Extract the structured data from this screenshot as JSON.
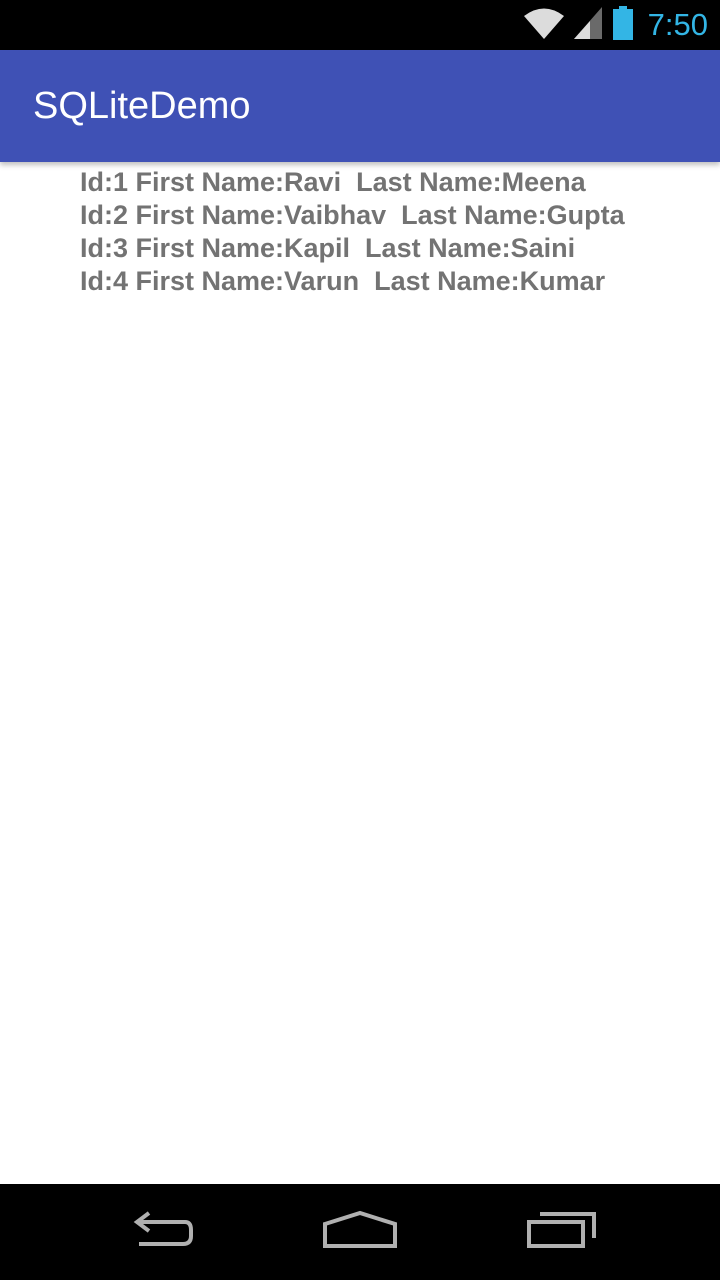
{
  "status_bar": {
    "time": "7:50",
    "icons": [
      "wifi-icon",
      "cellular-signal-icon",
      "battery-icon"
    ],
    "colors": {
      "background": "#000000",
      "time": "#33b5e5",
      "battery": "#33b5e5",
      "icons": "#dcdcdc"
    }
  },
  "app_bar": {
    "title": "SQLiteDemo",
    "color": "#3f51b5"
  },
  "records": [
    {
      "text": "Id:1 First Name:Ravi  Last Name:Meena"
    },
    {
      "text": "Id:2 First Name:Vaibhav  Last Name:Gupta"
    },
    {
      "text": "Id:3 First Name:Kapil  Last Name:Saini"
    },
    {
      "text": "Id:4 First Name:Varun  Last Name:Kumar"
    }
  ],
  "record_text_color": "#737373",
  "nav_bar": {
    "buttons": [
      "back-icon",
      "home-icon",
      "recents-icon"
    ],
    "icon_color": "#b0b0b0"
  }
}
